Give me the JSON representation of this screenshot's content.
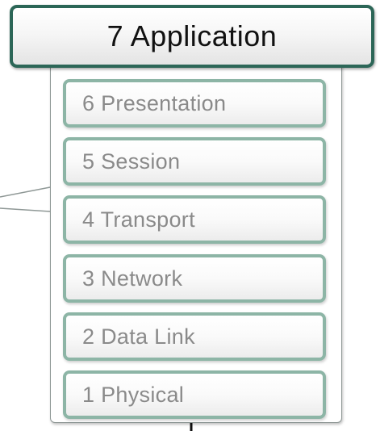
{
  "diagram": {
    "top_layer": "7 Application",
    "layers": [
      "6 Presentation",
      "5 Session",
      "4 Transport",
      "3 Network",
      "2 Data Link",
      "1 Physical"
    ]
  },
  "colors": {
    "top_border": "#2c6657",
    "layer_border": "#8db5a6",
    "layer_text": "#8a8a8a",
    "top_text": "#111111"
  }
}
